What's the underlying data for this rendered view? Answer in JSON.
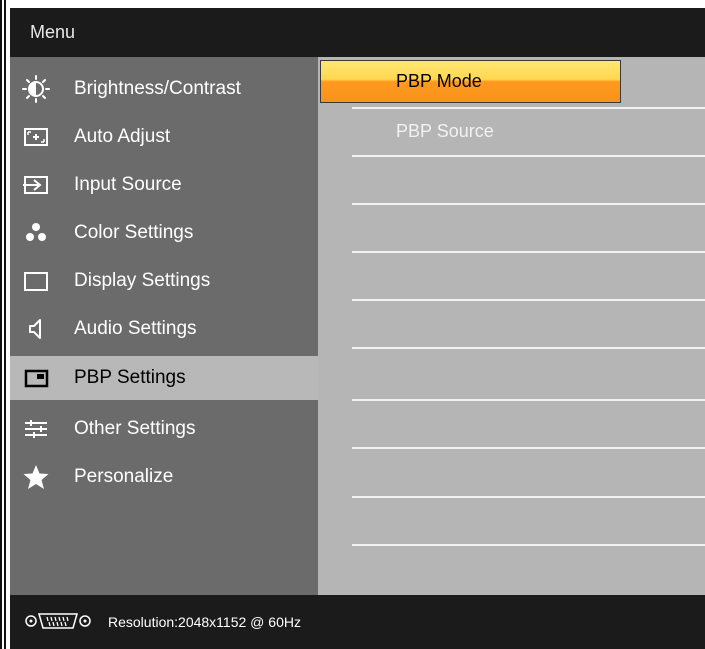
{
  "menu": {
    "title": "Menu"
  },
  "sidebar": {
    "items": [
      {
        "label": "Brightness/Contrast",
        "icon": "brightness-icon"
      },
      {
        "label": "Auto Adjust",
        "icon": "auto-adjust-icon"
      },
      {
        "label": "Input Source",
        "icon": "input-source-icon"
      },
      {
        "label": "Color Settings",
        "icon": "color-settings-icon"
      },
      {
        "label": "Display Settings",
        "icon": "display-settings-icon"
      },
      {
        "label": "Audio Settings",
        "icon": "speaker-icon"
      },
      {
        "label": "PBP Settings",
        "icon": "pbp-icon",
        "selected": true
      },
      {
        "label": "Other Settings",
        "icon": "sliders-icon"
      },
      {
        "label": "Personalize",
        "icon": "star-icon"
      }
    ]
  },
  "submenu": {
    "items": [
      {
        "label": "PBP Mode",
        "highlighted": true
      },
      {
        "label": "PBP Source"
      }
    ]
  },
  "footer": {
    "connector_icon": "vga-connector-icon",
    "resolution": "Resolution:2048x1152 @ 60Hz"
  },
  "colors": {
    "header_bg": "#1b1b1b",
    "sidebar_bg": "#6b6b6b",
    "selected_bg": "#b8b8b8",
    "content_bg": "#b5b5b5",
    "highlight_top": "#ffe872",
    "highlight_bottom": "#f9921a"
  }
}
